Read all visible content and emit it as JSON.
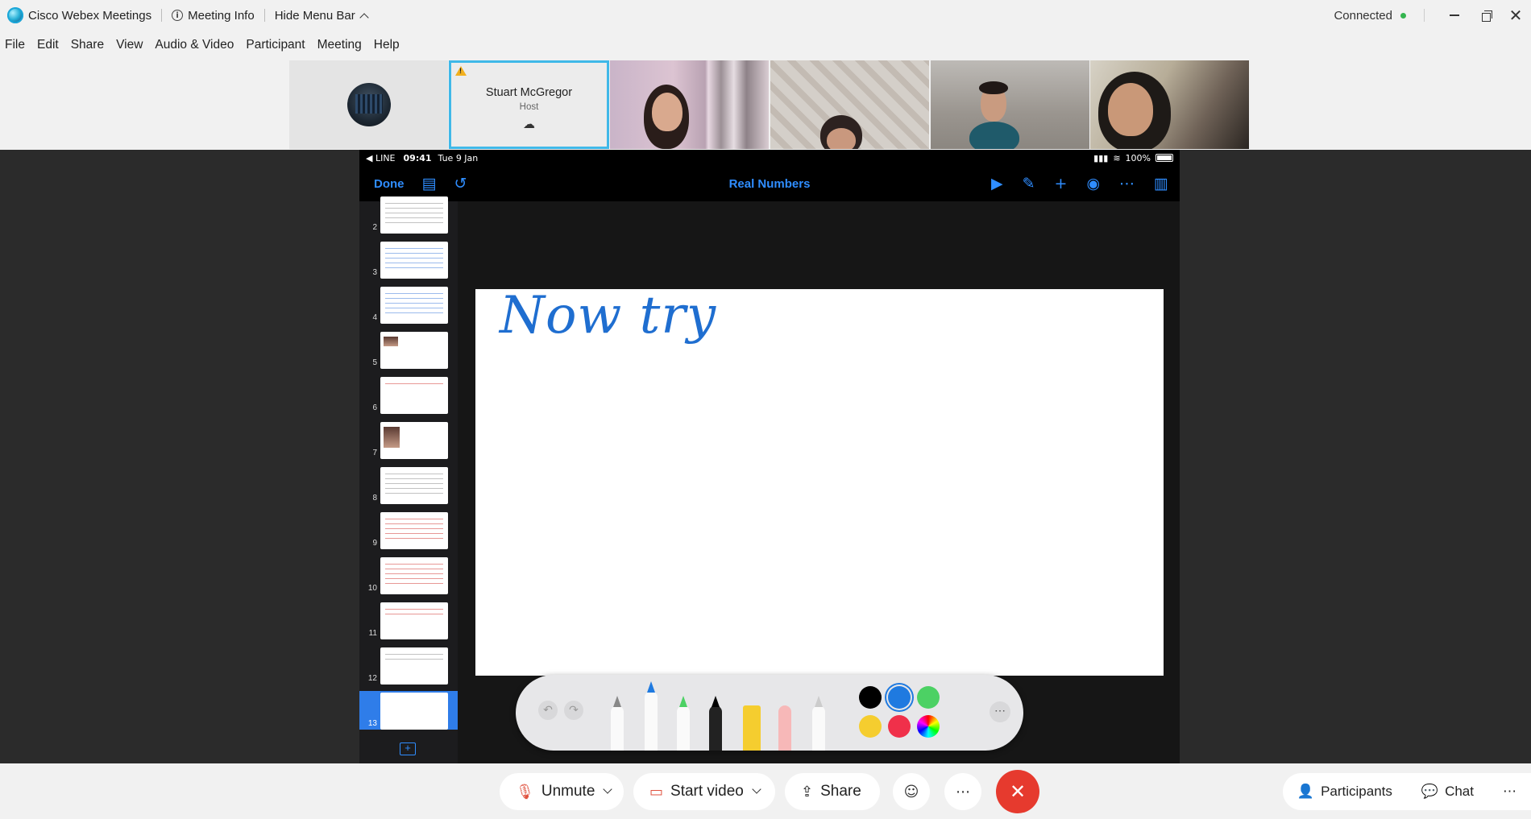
{
  "window": {
    "app_name": "Cisco Webex Meetings",
    "meeting_info_label": "Meeting Info",
    "hide_menu_label": "Hide Menu Bar",
    "connection_status": "Connected",
    "status_color": "#34b54f"
  },
  "menu": {
    "items": [
      "File",
      "Edit",
      "Share",
      "View",
      "Audio & Video",
      "Participant",
      "Meeting",
      "Help"
    ]
  },
  "filmstrip": {
    "host": {
      "name": "Stuart McGregor",
      "role": "Host"
    },
    "highlight_color": "#3fb8e8"
  },
  "ipad": {
    "status": {
      "carrier": "◀ LINE",
      "time": "09:41",
      "date": "Tue 9 Jan",
      "battery": "100%"
    },
    "toolbar": {
      "done_label": "Done",
      "document_title": "Real Numbers"
    },
    "slides": {
      "numbers": [
        "2",
        "3",
        "4",
        "5",
        "6",
        "7",
        "8",
        "9",
        "10",
        "11",
        "12",
        "13"
      ],
      "selected": "13"
    },
    "canvas": {
      "handwriting": "Now try"
    },
    "pencil_colors": [
      "#000000",
      "#1f7ae0",
      "#4cd164",
      "#f5cd2f",
      "#f0304a",
      "rainbow"
    ]
  },
  "controls": {
    "unmute_label": "Unmute",
    "start_video_label": "Start video",
    "share_label": "Share",
    "participants_label": "Participants",
    "chat_label": "Chat",
    "leave_color": "#e63a2e"
  }
}
